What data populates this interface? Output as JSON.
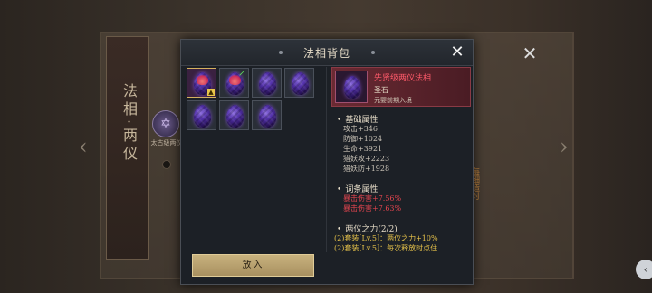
{
  "background": {
    "left_title": "法相·两仪",
    "side_text": "每细造时",
    "item_label": "太古级两仪",
    "close_label": "✕",
    "left_arrow": "‹",
    "right_arrow": "›",
    "corner_icon": "chevron-left-icon"
  },
  "dialog": {
    "title": "法相背包",
    "close_label": "✕"
  },
  "inventory": {
    "items": [
      {
        "name": "egg-selected",
        "selected": true,
        "flame": true,
        "badge": true
      },
      {
        "name": "egg-equipped",
        "selected": false,
        "flame": true,
        "equipped": true
      },
      {
        "name": "egg"
      },
      {
        "name": "egg"
      },
      {
        "name": "egg"
      },
      {
        "name": "egg"
      },
      {
        "name": "egg"
      }
    ]
  },
  "detail": {
    "name": "先贤级两仪法相",
    "type": "圣石",
    "desc": "元婴前期入境",
    "base_title": "基础属性",
    "base_stats": [
      "攻击+346",
      "防御+1024",
      "生命+3921",
      "猎妖攻+2223",
      "猎妖防+1928"
    ],
    "affix_title": "词条属性",
    "affix_stats": [
      "暴击伤害+7.56%",
      "暴击伤害+7.63%"
    ],
    "set_title": "两仪之力(2/2)",
    "set_stats": [
      "(2)套装[Lv.5]：两仪之力+10%",
      "(2)套装[Lv.5]：每次释放时点住"
    ]
  },
  "put_button": "放入",
  "colors": {
    "accent_gold": "#c8b27e",
    "rarity_red": "#ff5a6a",
    "set_yellow": "#e6c24a"
  }
}
